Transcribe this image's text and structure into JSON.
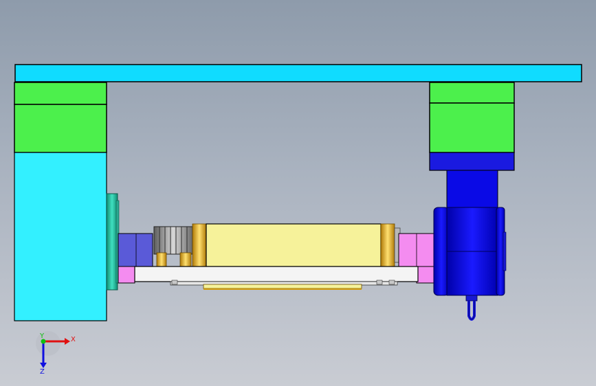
{
  "viewport": {
    "background_top": "#8e9bab",
    "background_bottom": "#c9ccd3"
  },
  "colors": {
    "cyan_beam": "#10dcff",
    "cyan_post": "#33f0ff",
    "green_block": "#4cf04c",
    "navy_block": "#1a1ae0",
    "blue_motor": "#0a0ae6",
    "yellow_body": "#f6f29a",
    "gold": "#e0b020",
    "pink": "#f48cf0",
    "slate_blue": "#5a5ad8",
    "white_plate": "#f4f4f4",
    "gear_gray": "#9a9a9a",
    "teal_flange": "#20c8a8"
  },
  "triad": {
    "x_label": "X",
    "y_label": "Y",
    "z_label": "Z",
    "x_color": "#e01010",
    "y_color": "#10c010",
    "z_color": "#1010e0"
  }
}
